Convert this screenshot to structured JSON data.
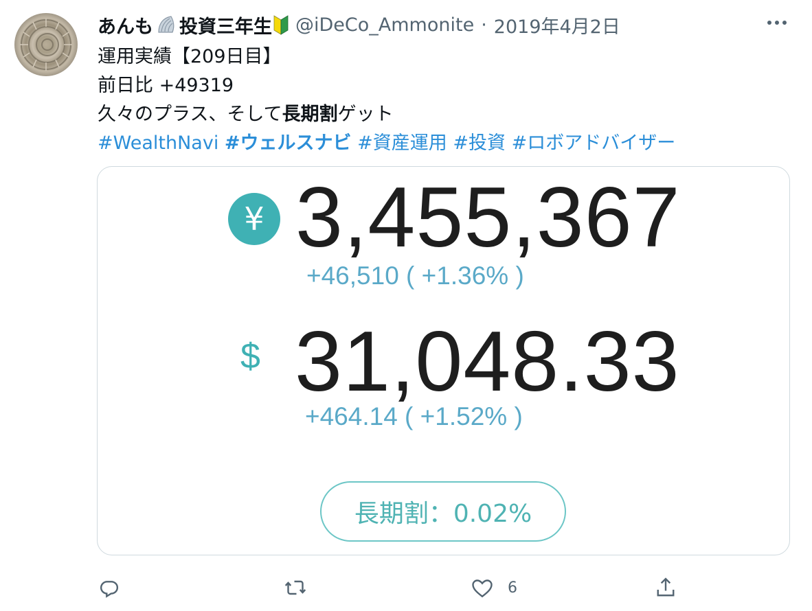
{
  "tweet": {
    "author_name": "あんも",
    "author_title": "投資三年生",
    "handle": "@iDeCo_Ammonite",
    "separator": "·",
    "date": "2019年4月2日",
    "lines": {
      "l1": "運用実績【209日目】",
      "l2": "前日比 +49319",
      "l3_pre": "久々のプラス、そして",
      "l3_bold": "長期割",
      "l3_post": "ゲット"
    },
    "hashtags": {
      "h1": "#WealthNavi",
      "h2": "#ウェルスナビ",
      "h3": "#資産運用",
      "h4": "#投資",
      "h5": "#ロボアドバイザー"
    }
  },
  "card": {
    "yen_symbol": "¥",
    "yen_value": "3,455,367",
    "yen_delta": "+46,510 ( +1.36% )",
    "dollar_symbol": "$",
    "dollar_value": "31,048.33",
    "dollar_delta": "+464.14 ( +1.52% )",
    "discount_label": "長期割：0.02%"
  },
  "actions": {
    "reply_icon": "reply-icon",
    "retweet_icon": "retweet-icon",
    "like_icon": "heart-icon",
    "like_count": "6",
    "share_icon": "share-icon"
  },
  "colors": {
    "accent_teal": "#3fb1b4",
    "link_blue": "#2b8ed8",
    "delta_blue": "#5aa9c8",
    "muted": "#536471"
  }
}
